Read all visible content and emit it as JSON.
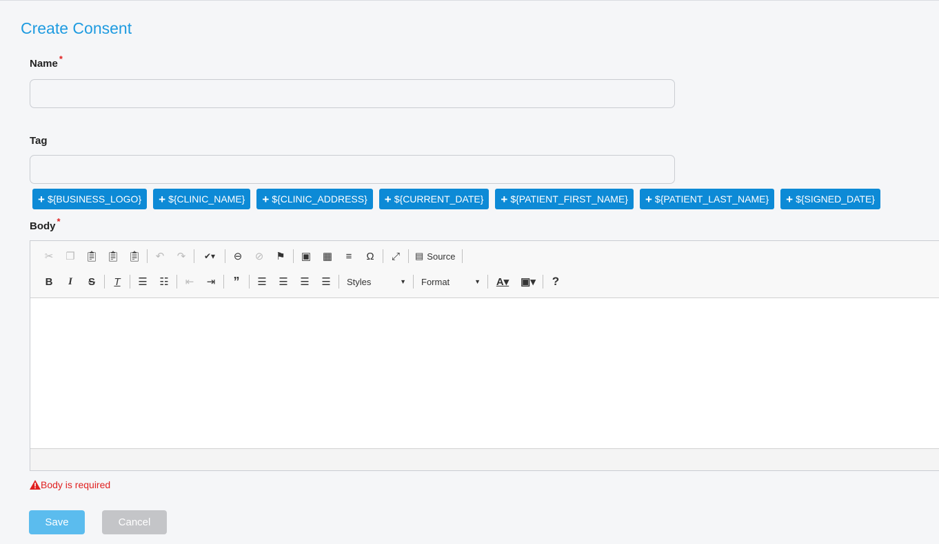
{
  "page": {
    "title": "Create Consent"
  },
  "form": {
    "name_label": "Name",
    "name_required_mark": "*",
    "name_value": "",
    "tag_label": "Tag",
    "tag_value": "",
    "body_label": "Body",
    "body_required_mark": "*",
    "body_error": "Body is required"
  },
  "chips": [
    {
      "label": "${BUSINESS_LOGO}"
    },
    {
      "label": "${CLINIC_NAME}"
    },
    {
      "label": "${CLINIC_ADDRESS}"
    },
    {
      "label": "${CURRENT_DATE}"
    },
    {
      "label": "${PATIENT_FIRST_NAME}"
    },
    {
      "label": "${PATIENT_LAST_NAME}"
    },
    {
      "label": "${SIGNED_DATE}"
    }
  ],
  "editor": {
    "source_label": "Source",
    "styles_label": "Styles",
    "format_label": "Format",
    "help_label": "?"
  },
  "buttons": {
    "save": "Save",
    "cancel": "Cancel"
  },
  "colors": {
    "accent": "#1e9be0",
    "chip": "#0d8ad6",
    "save": "#5bbcee",
    "cancel": "#c4c5c8",
    "error": "#e02020"
  }
}
